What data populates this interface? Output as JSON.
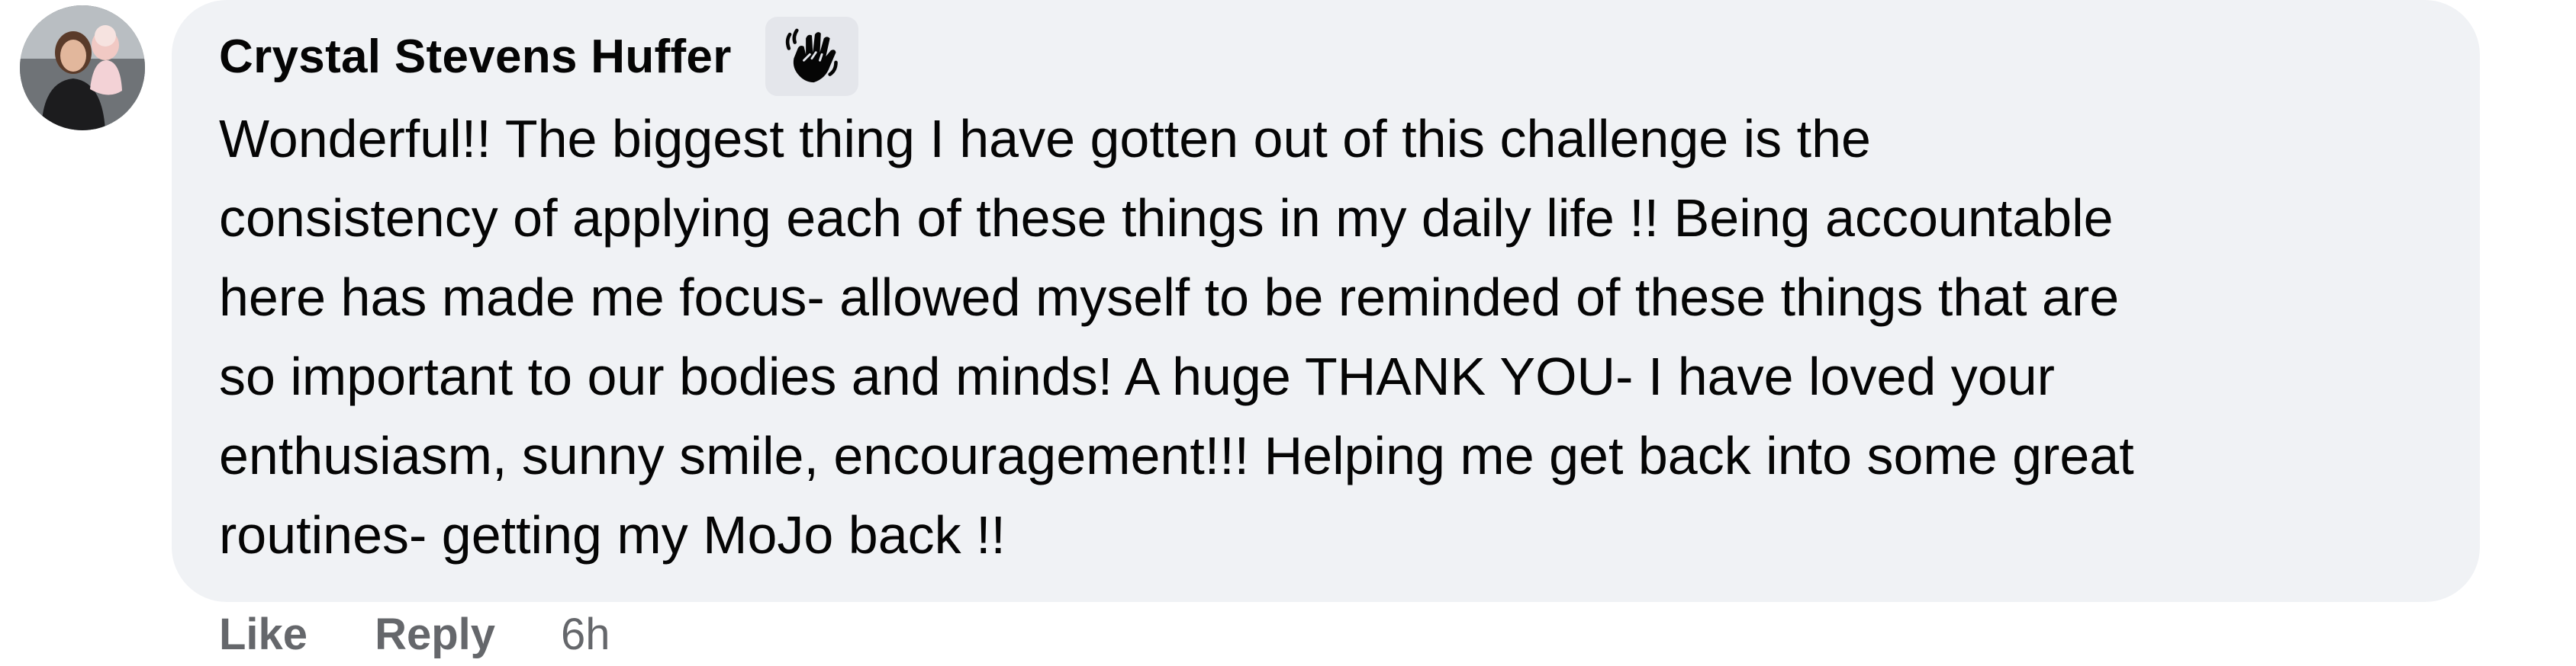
{
  "comment": {
    "author_name": "Crystal Stevens Huffer",
    "badge_icon": "waving-hand-icon",
    "avatar_icon": "profile-photo-avatar",
    "text": "Wonderful!! The biggest thing I have gotten out of this challenge is the\nconsistency of applying each of these things in my daily life !! Being accountable\nhere has made me focus- allowed myself to be reminded of these things that are\nso important to our bodies and minds! A huge THANK YOU- I have loved your\nenthusiasm, sunny smile, encouragement!!! Helping me get back into some great\nroutines- getting my MoJo back !!",
    "bubble_color": "#f0f2f5",
    "text_color": "#050505"
  },
  "actions": {
    "like_label": "Like",
    "reply_label": "Reply",
    "timestamp": "6h",
    "action_color": "#65676b"
  }
}
